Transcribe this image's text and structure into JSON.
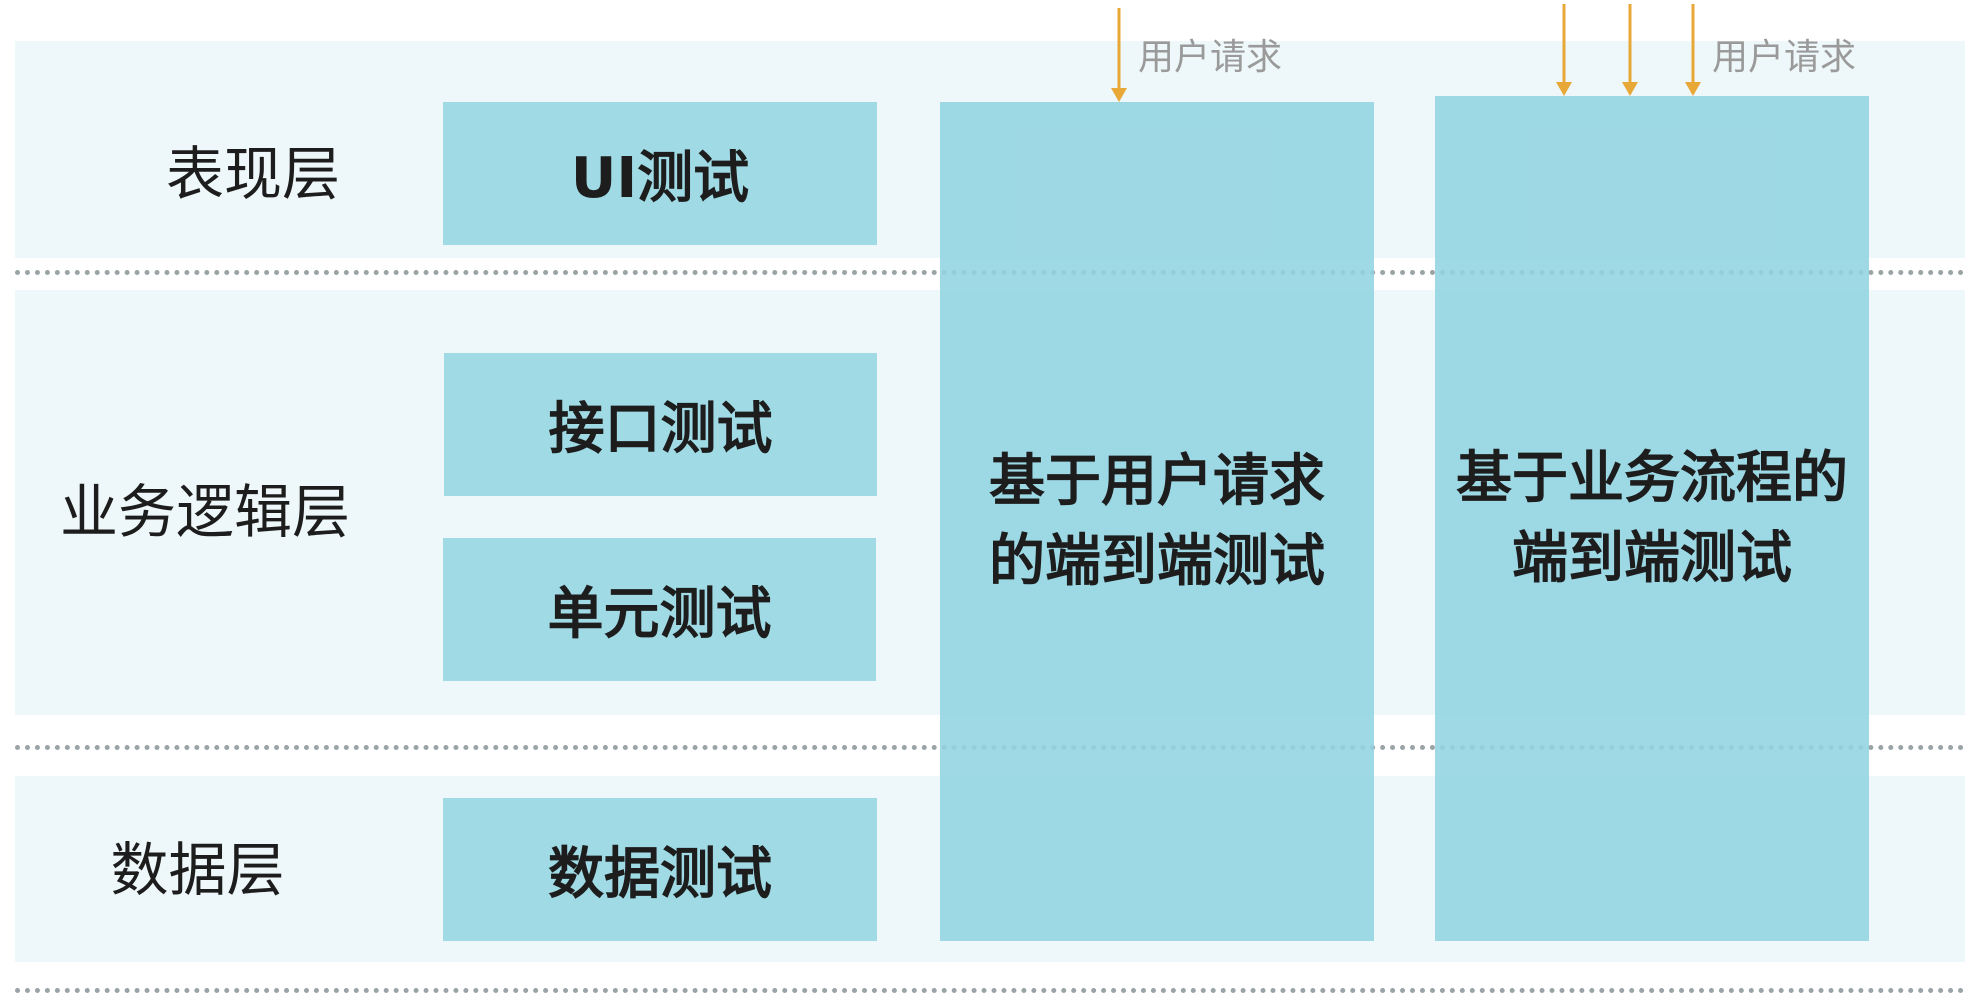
{
  "colors": {
    "band": "#eef7f9",
    "box": "#9fdae5",
    "column": "#92d4e1",
    "arrow": "#e8a838",
    "divider": "#9aa3a6"
  },
  "layers": [
    {
      "label": "表现层"
    },
    {
      "label": "业务逻辑层"
    },
    {
      "label": "数据层"
    }
  ],
  "test_boxes": [
    {
      "label": "UI测试"
    },
    {
      "label": "接口测试"
    },
    {
      "label": "单元测试"
    },
    {
      "label": "数据测试"
    }
  ],
  "columns": [
    {
      "line1": "基于用户请求",
      "line2": "的端到端测试",
      "request_label": "用户请求"
    },
    {
      "line1": "基于业务流程的",
      "line2": "端到端测试",
      "request_label": "用户请求"
    }
  ]
}
